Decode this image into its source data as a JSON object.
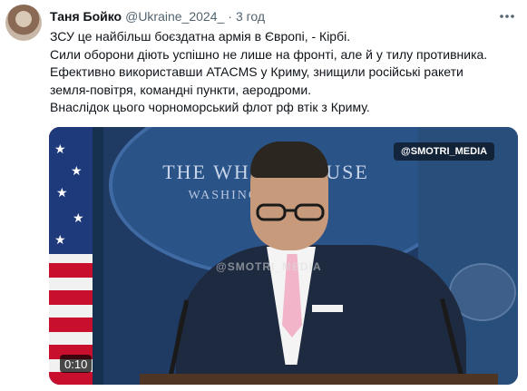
{
  "tweet": {
    "author_name": "Таня Бойко",
    "handle": "@Ukraine_2024_",
    "separator": "·",
    "time": "3 год",
    "lines": [
      "ЗСУ це найбільш боєздатна армія в Європі, - Кірбі.",
      "Сили оборони діють успішно не лише на фронті, але й у тилу противника.",
      "Ефективно використавши ATACMS у Криму, знищили російські ракети",
      "земля-повітря, командні пункти, аеродроми.",
      "Внаслідок цього чорноморський флот рф втік з Криму."
    ]
  },
  "video": {
    "watermark": "@SMOTRI_MEDIA",
    "center_watermark": "@SMOTRI_MEDIA",
    "backdrop_line1": "THE WHITE HOUSE",
    "backdrop_line2": "WASHINGTON",
    "duration": "0:10"
  },
  "icons": {
    "more": "more-horizontal-icon"
  }
}
